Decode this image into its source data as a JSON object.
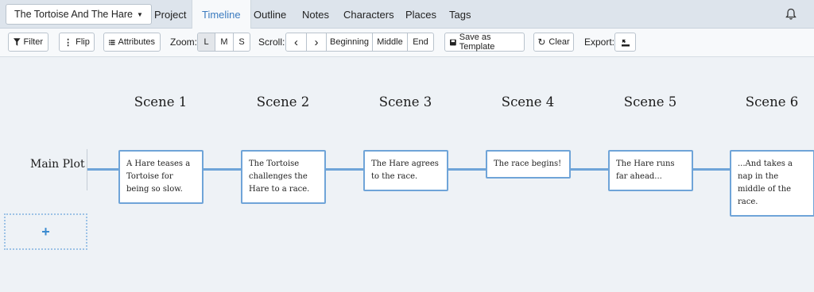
{
  "nav": {
    "story_title": "The Tortoise And The Hare",
    "tabs": [
      "Project",
      "Timeline",
      "Outline",
      "Notes",
      "Characters",
      "Places",
      "Tags"
    ],
    "active_tab": "Timeline"
  },
  "toolbar": {
    "filter_label": "Filter",
    "flip_label": "Flip",
    "attributes_label": "Attributes",
    "zoom_label": "Zoom:",
    "zoom_options": [
      "L",
      "M",
      "S"
    ],
    "zoom_selected": "L",
    "scroll_label": "Scroll:",
    "scroll_left": "‹",
    "scroll_right": "›",
    "scroll_beginning": "Beginning",
    "scroll_middle": "Middle",
    "scroll_end": "End",
    "save_template_label": "Save as Template",
    "clear_label": "Clear",
    "export_label": "Export:"
  },
  "timeline": {
    "scenes": [
      "Scene 1",
      "Scene 2",
      "Scene 3",
      "Scene 4",
      "Scene 5",
      "Scene 6"
    ],
    "plot_line": "Main Plot",
    "cards": [
      "A Hare teases a Tortoise for being so slow.",
      "The Tortoise challenges the Hare to a race.",
      "The Hare agrees to the race.",
      "The race begins!",
      "The Hare runs far ahead...",
      "...And takes a nap in the middle of the race."
    ],
    "add_label": "+"
  },
  "colors": {
    "accent": "#3b7bbf",
    "line": "#6fa4d8",
    "nav_bg": "#dde4ec",
    "page_bg": "#eef2f6"
  },
  "icons": [
    "chevron-down-icon",
    "bell-icon",
    "filter-icon",
    "flip-icon",
    "list-icon",
    "save-icon",
    "refresh-icon",
    "export-icon"
  ]
}
